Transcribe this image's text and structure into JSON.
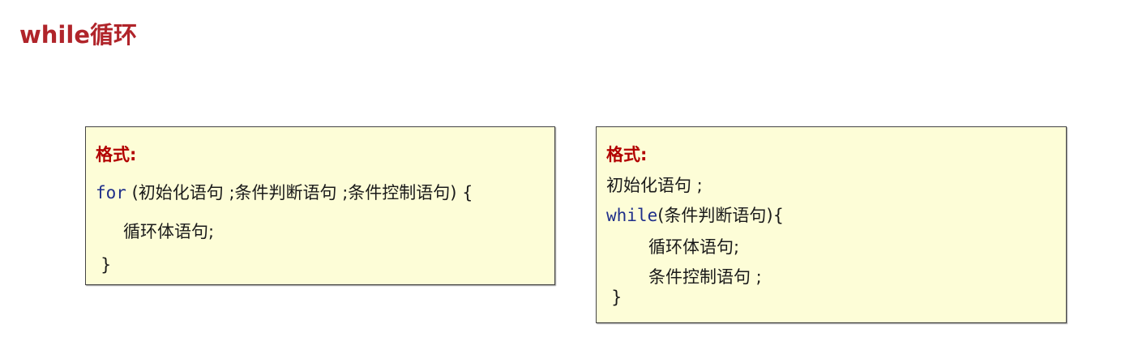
{
  "title": "while循环",
  "for_box": {
    "header": "格式:",
    "keyword": "for",
    "line1_rest": " (初始化语句 ;条件判断语句 ;条件控制语句) {",
    "line2": "循环体语句;",
    "line3": "}"
  },
  "while_box": {
    "header": "格式:",
    "line1": "初始化语句 ;",
    "keyword": "while",
    "line2_rest": "(条件判断语句){",
    "line3": "循环体语句;",
    "line4": "条件控制语句 ;",
    "line5": "}"
  }
}
